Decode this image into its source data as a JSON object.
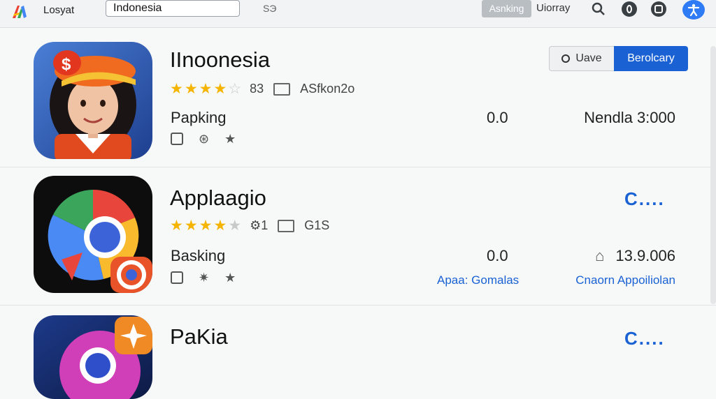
{
  "topbar": {
    "brand": "Losyat",
    "search_value": "Indonesia",
    "search_right": "ЅЭ",
    "seg_active": "Asnking",
    "seg_other": "Uiorray"
  },
  "apps": [
    {
      "name": "IInoonesia",
      "stars": 4,
      "rating_num": "83",
      "meta_text": "ASfkon2o",
      "category": "Papking",
      "value": "0.0",
      "stat": "Nendla 3:000",
      "btn_outline": "Uave",
      "btn_primary": "Berolcary"
    },
    {
      "name": "Applaagio",
      "stars": 4,
      "rating_num": "1",
      "meta_text": "G1S",
      "category": "Basking",
      "value": "0.0",
      "stat": "13.9.006",
      "loading": "C....",
      "link_a": "Apaa: Gomalas",
      "link_b": "Cnaorn Appoiliolan"
    },
    {
      "name": "PaKia",
      "loading": "C...."
    }
  ],
  "colors": {
    "accent": "#1a62d4",
    "star": "#f4b400"
  }
}
